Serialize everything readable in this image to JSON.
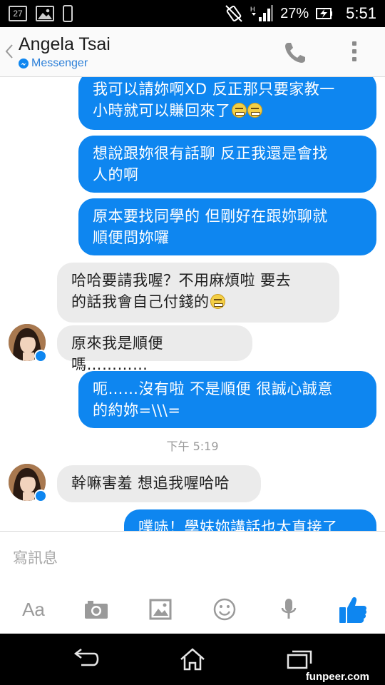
{
  "status_bar": {
    "calendar_day": "27",
    "battery_percent": "27%",
    "time": "5:51"
  },
  "header": {
    "contact_name": "Angela Tsai",
    "app_label": "Messenger"
  },
  "messages": {
    "m1": {
      "line1": "我可以請妳啊XD 反正那只要家教一",
      "line2": "小時就可以賺回來了"
    },
    "m2": {
      "line1": "想說跟妳很有話聊  反正我還是會找",
      "line2": "人的啊"
    },
    "m3": {
      "line1": "原本要找同學的 但剛好在跟妳聊就",
      "line2": "順便問妳囉"
    },
    "m4": {
      "line1": "哈哈要請我喔？不用麻煩啦 要去",
      "line2": "的話我會自己付錢的"
    },
    "m5": {
      "line1": "原來我是順便嗎…………"
    },
    "m6": {
      "line1": "呃……沒有啦 不是順便 很誠心誠意",
      "line2": "的約妳=\\\\\\="
    },
    "timestamp": "下午 5:19",
    "m7": {
      "line1": "幹嘛害羞 想追我喔哈哈"
    },
    "m8": {
      "line1": "噗哧！學妹妳講話也太直接了"
    }
  },
  "composer": {
    "placeholder": "寫訊息",
    "text_tool_label": "Aa"
  },
  "icons": {
    "messenger": "messenger-icon",
    "call": "phone-icon",
    "more": "more-vert-icon",
    "camera": "camera-icon",
    "gallery": "image-icon",
    "emoji": "smiley-icon",
    "mic": "microphone-icon",
    "like": "thumbs-up-icon",
    "back": "back-icon",
    "home": "home-icon",
    "recents": "recents-icon"
  },
  "colors": {
    "outgoing_bubble": "#0e86f0",
    "incoming_bubble": "#ebebeb",
    "accent": "#0e86f0"
  },
  "watermark": "funpeer.com"
}
